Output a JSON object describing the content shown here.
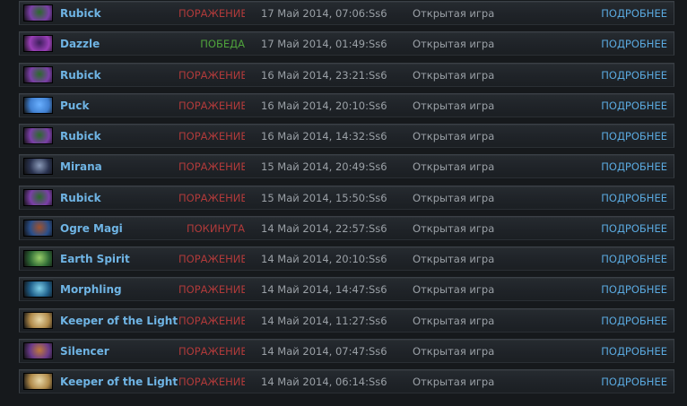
{
  "matches": [
    {
      "hero": "Rubick",
      "icon": "rubick-portrait-icon",
      "result": "ПОРАЖЕНИЕ",
      "result_type": "loss",
      "date": "17 Май 2014, 07:06:Ss6",
      "mode": "Открытая игра",
      "details": "ПОДРОБНЕЕ",
      "colors": [
        "#7b3fa8",
        "#2a6a2a"
      ]
    },
    {
      "hero": "Dazzle",
      "icon": "dazzle-portrait-icon",
      "result": "ПОБЕДА",
      "result_type": "win",
      "date": "17 Май 2014, 01:49:Ss6",
      "mode": "Открытая игра",
      "details": "ПОДРОБНЕЕ",
      "colors": [
        "#9a3fb8",
        "#3b1f5a"
      ]
    },
    {
      "hero": "Rubick",
      "icon": "rubick-portrait-icon",
      "result": "ПОРАЖЕНИЕ",
      "result_type": "loss",
      "date": "16 Май 2014, 23:21:Ss6",
      "mode": "Открытая игра",
      "details": "ПОДРОБНЕЕ",
      "colors": [
        "#7b3fa8",
        "#2a6a2a"
      ]
    },
    {
      "hero": "Puck",
      "icon": "puck-portrait-icon",
      "result": "ПОРАЖЕНИЕ",
      "result_type": "loss",
      "date": "16 Май 2014, 20:10:Ss6",
      "mode": "Открытая игра",
      "details": "ПОДРОБНЕЕ",
      "colors": [
        "#3f7fd0",
        "#6ab0ff"
      ]
    },
    {
      "hero": "Rubick",
      "icon": "rubick-portrait-icon",
      "result": "ПОРАЖЕНИЕ",
      "result_type": "loss",
      "date": "16 Май 2014, 14:32:Ss6",
      "mode": "Открытая игра",
      "details": "ПОДРОБНЕЕ",
      "colors": [
        "#7b3fa8",
        "#2a6a2a"
      ]
    },
    {
      "hero": "Mirana",
      "icon": "mirana-portrait-icon",
      "result": "ПОРАЖЕНИЕ",
      "result_type": "loss",
      "date": "15 Май 2014, 20:49:Ss6",
      "mode": "Открытая игра",
      "details": "ПОДРОБНЕЕ",
      "colors": [
        "#2a3350",
        "#8a9ab8"
      ]
    },
    {
      "hero": "Rubick",
      "icon": "rubick-portrait-icon",
      "result": "ПОРАЖЕНИЕ",
      "result_type": "loss",
      "date": "15 Май 2014, 15:50:Ss6",
      "mode": "Открытая игра",
      "details": "ПОДРОБНЕЕ",
      "colors": [
        "#7b3fa8",
        "#2a6a2a"
      ]
    },
    {
      "hero": "Ogre Magi",
      "icon": "ogre-magi-portrait-icon",
      "result": "ПОКИНУТА",
      "result_type": "abandon",
      "date": "14 Май 2014, 22:57:Ss6",
      "mode": "Открытая игра",
      "details": "ПОДРОБНЕЕ",
      "colors": [
        "#2a4f8a",
        "#a0522d"
      ]
    },
    {
      "hero": "Earth Spirit",
      "icon": "earth-spirit-portrait-icon",
      "result": "ПОРАЖЕНИЕ",
      "result_type": "loss",
      "date": "14 Май 2014, 20:10:Ss6",
      "mode": "Открытая игра",
      "details": "ПОДРОБНЕЕ",
      "colors": [
        "#2f6a35",
        "#9ad06a"
      ]
    },
    {
      "hero": "Morphling",
      "icon": "morphling-portrait-icon",
      "result": "ПОРАЖЕНИЕ",
      "result_type": "loss",
      "date": "14 Май 2014, 14:47:Ss6",
      "mode": "Открытая игра",
      "details": "ПОДРОБНЕЕ",
      "colors": [
        "#1f5f8a",
        "#7fd0e8"
      ]
    },
    {
      "hero": "Keeper of the Light",
      "icon": "keeper-of-the-light-portrait-icon",
      "result": "ПОРАЖЕНИЕ",
      "result_type": "loss",
      "date": "14 Май 2014, 11:27:Ss6",
      "mode": "Открытая игра",
      "details": "ПОДРОБНЕЕ",
      "colors": [
        "#b08a4a",
        "#e8d8a8"
      ]
    },
    {
      "hero": "Silencer",
      "icon": "silencer-portrait-icon",
      "result": "ПОРАЖЕНИЕ",
      "result_type": "loss",
      "date": "14 Май 2014, 07:47:Ss6",
      "mode": "Открытая игра",
      "details": "ПОДРОБНЕЕ",
      "colors": [
        "#6a3a8a",
        "#c07a3a"
      ]
    },
    {
      "hero": "Keeper of the Light",
      "icon": "keeper-of-the-light-portrait-icon",
      "result": "ПОРАЖЕНИЕ",
      "result_type": "loss",
      "date": "14 Май 2014, 06:14:Ss6",
      "mode": "Открытая игра",
      "details": "ПОДРОБНЕЕ",
      "colors": [
        "#b08a4a",
        "#e8d8a8"
      ]
    }
  ]
}
